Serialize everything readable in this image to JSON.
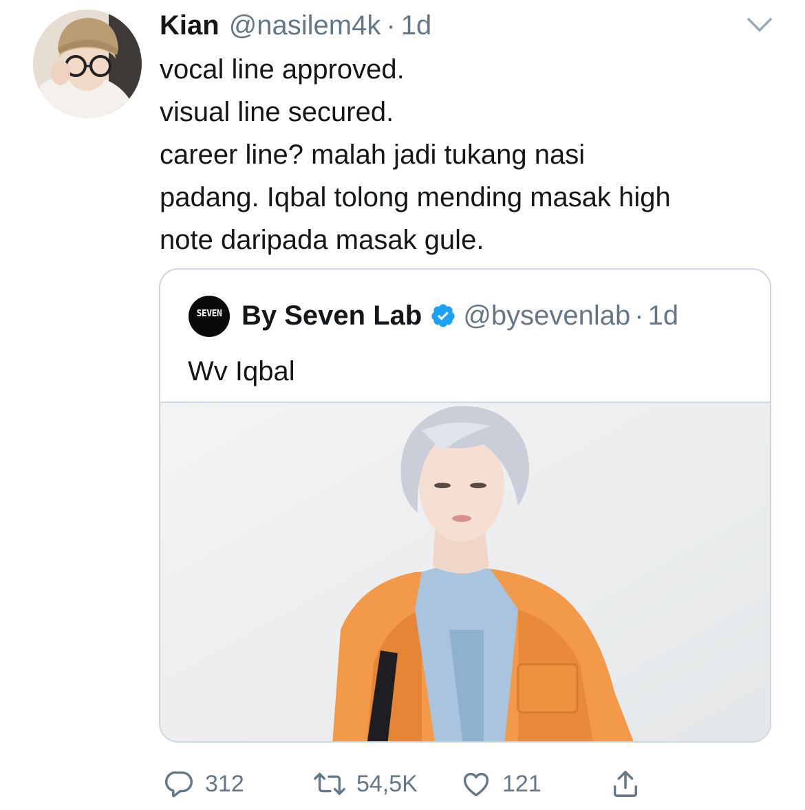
{
  "tweet": {
    "author": {
      "name": "Kian",
      "handle": "@nasilem4k"
    },
    "separator": "·",
    "time": "1d",
    "lines": [
      "vocal line approved.",
      "visual line secured.",
      "career line? malah jadi tukang nasi",
      "padang. Iqbal tolong mending masak high",
      "note daripada masak gule."
    ]
  },
  "quote": {
    "avatar_text": "SEVEN",
    "author": {
      "name": "By Seven Lab",
      "handle": "@bysevenlab",
      "verified": true
    },
    "separator": "·",
    "time": "1d",
    "text": "Wv Iqbal"
  },
  "actions": {
    "reply_count": "312",
    "retweet_count": "54,5K",
    "like_count": "121"
  },
  "colors": {
    "text_primary": "#14171a",
    "text_secondary": "#657786",
    "border": "#ccd6dd",
    "verified_blue": "#1da1f2"
  },
  "icons": {
    "menu": "chevron-down-icon",
    "verified": "verified-badge-icon",
    "reply": "reply-icon",
    "retweet": "retweet-icon",
    "like": "heart-icon",
    "share": "share-icon"
  }
}
